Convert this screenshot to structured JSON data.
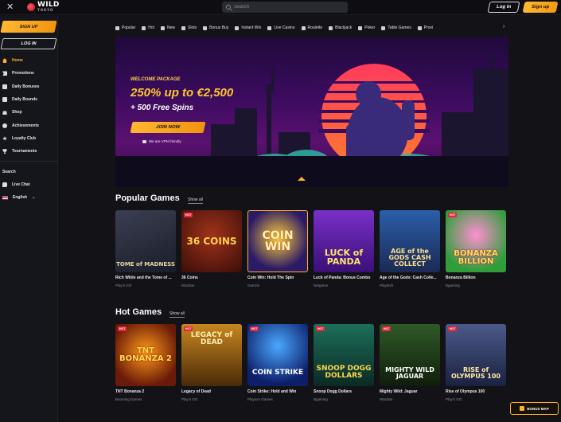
{
  "topbar": {
    "logo_main": "WILD",
    "logo_sub": "TOKYO",
    "search_placeholder": "Search",
    "login_label": "Log In",
    "signup_label": "Sign up"
  },
  "sidebar": {
    "signup_label": "SIGN UP",
    "login_label": "LOG IN",
    "items": [
      {
        "label": "Home",
        "icon": "home-icon",
        "active": true
      },
      {
        "label": "Promotions",
        "icon": "promotions-icon"
      },
      {
        "label": "Daily Bonuses",
        "icon": "gift-icon"
      },
      {
        "label": "Daily Bounds",
        "icon": "gift-icon"
      },
      {
        "label": "Shop",
        "icon": "shop-bag-icon"
      },
      {
        "label": "Achievements",
        "icon": "medal-icon"
      },
      {
        "label": "Loyalty Club",
        "icon": "star-icon"
      },
      {
        "label": "Tournaments",
        "icon": "trophy-icon"
      }
    ],
    "search_label": "Search",
    "live_chat_label": "Live Chat",
    "language_label": "English"
  },
  "categories": [
    {
      "label": "Popular"
    },
    {
      "label": "Hot"
    },
    {
      "label": "New"
    },
    {
      "label": "Slots"
    },
    {
      "label": "Bonus Buy"
    },
    {
      "label": "Instant Win"
    },
    {
      "label": "Live Casino"
    },
    {
      "label": "Roulette"
    },
    {
      "label": "Blackjack"
    },
    {
      "label": "Poker"
    },
    {
      "label": "Table Games"
    },
    {
      "label": "Provi"
    }
  ],
  "hero": {
    "welcome": "WELCOME PACKAGE",
    "offer_line1": "250% up to €2,500",
    "offer_line2": "+ 500 Free Spins",
    "cta": "JOIN NOW",
    "vpn": "We are VPN friendly"
  },
  "popular": {
    "title": "Popular Games",
    "show_all": "Show all",
    "games": [
      {
        "name": "Rich Wilde and the Tome of ...",
        "provider": "Play'n GO",
        "hot": false,
        "art": "TOME of MADNESS"
      },
      {
        "name": "36 Coins",
        "provider": "Wazdan",
        "hot": true,
        "art": "36 COINS"
      },
      {
        "name": "Coin Win: Hold The Spin",
        "provider": "Gamzix",
        "hot": false,
        "art": "COIN WIN"
      },
      {
        "name": "Luck of Panda: Bonus Combo",
        "provider": "Netgame",
        "hot": false,
        "art": "LUCK of PANDA"
      },
      {
        "name": "Age of the Gods: Cash Colle...",
        "provider": "Playtech",
        "hot": false,
        "art": "AGE of the GODS CASH COLLECT"
      },
      {
        "name": "Bonanza Billion",
        "provider": "Bgaming",
        "hot": true,
        "art": "BONANZA BILLION"
      }
    ]
  },
  "hot": {
    "title": "Hot Games",
    "show_all": "Show all",
    "games": [
      {
        "name": "TNT Bonanza 2",
        "provider": "Booming Games",
        "hot": true,
        "art": "TNT BONANZA 2"
      },
      {
        "name": "Legacy of Dead",
        "provider": "Play'n GO",
        "hot": true,
        "art": "LEGACY of DEAD"
      },
      {
        "name": "Coin Strike: Hold and Win",
        "provider": "Playson Games",
        "hot": true,
        "art": "COIN STRIKE"
      },
      {
        "name": "Snoop Dogg Dollars",
        "provider": "Bgaming",
        "hot": true,
        "art": "SNOOP DOGG DOLLARS"
      },
      {
        "name": "Mighty Wild: Jaguar",
        "provider": "Wazdan",
        "hot": true,
        "art": "MIGHTY WILD JAGUAR"
      },
      {
        "name": "Rise of Olympus 100",
        "provider": "Play'n GO",
        "hot": true,
        "art": "RISE of OLYMPUS 100"
      }
    ]
  },
  "bonus_map_label": "BONUS MAP",
  "colors": {
    "accent": "#ffb02e",
    "hot": "#e8253c",
    "bg": "#121217"
  }
}
